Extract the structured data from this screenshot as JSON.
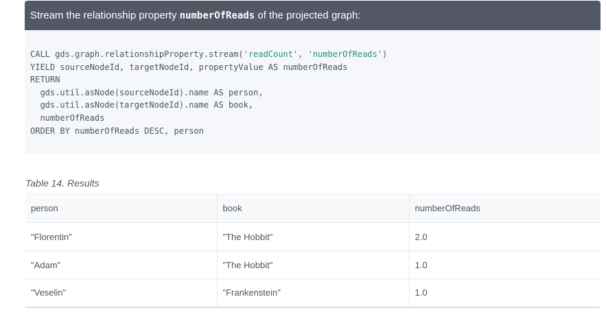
{
  "example": {
    "title_prefix": "Stream the relationship property ",
    "title_code": "numberOfReads",
    "title_suffix": " of the projected graph:"
  },
  "code": {
    "lines": [
      {
        "pre": "CALL gds.graph.relationshipProperty.stream(",
        "s1": "'readCount'",
        "mid": ", ",
        "s2": "'numberOfReads'",
        "post": ")"
      },
      {
        "text": "YIELD sourceNodeId, targetNodeId, propertyValue AS numberOfReads"
      },
      {
        "text": "RETURN"
      },
      {
        "text": "  gds.util.asNode(sourceNodeId).name AS person,"
      },
      {
        "text": "  gds.util.asNode(targetNodeId).name AS book,"
      },
      {
        "text": "  numberOfReads"
      },
      {
        "text": "ORDER BY numberOfReads DESC, person"
      }
    ]
  },
  "table": {
    "caption": "Table 14. Results",
    "headers": [
      "person",
      "book",
      "numberOfReads"
    ],
    "rows": [
      [
        "\"Florentin\"",
        "\"The Hobbit\"",
        "2.0"
      ],
      [
        "\"Adam\"",
        "\"The Hobbit\"",
        "1.0"
      ],
      [
        "\"Veselin\"",
        "\"Frankenstein\"",
        "1.0"
      ]
    ]
  }
}
